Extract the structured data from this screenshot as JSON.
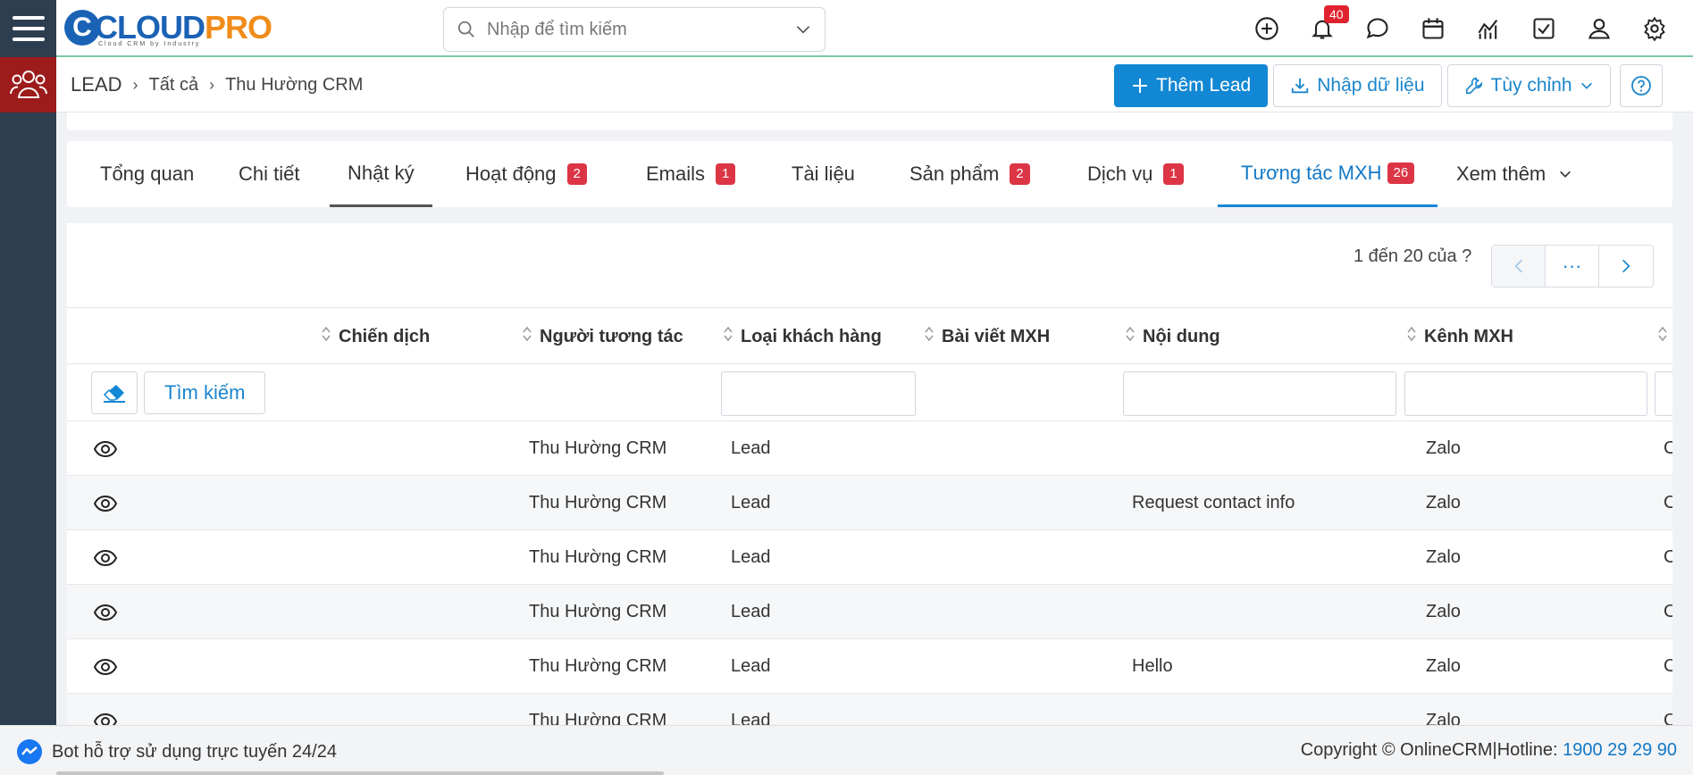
{
  "app": {
    "logo_brand": "CLOUDPRO",
    "logo_first": "CLOUD",
    "logo_second": "PRO",
    "logo_tagline": "Cloud CRM by Industry"
  },
  "header": {
    "search_placeholder": "Nhập để tìm kiếm",
    "notification_count": "40"
  },
  "breadcrumb": {
    "module": "LEAD",
    "level2": "Tất cả",
    "record": "Thu Hường CRM"
  },
  "actions": {
    "add": "Thêm Lead",
    "import": "Nhập dữ liệu",
    "customize": "Tùy chỉnh"
  },
  "tabs": [
    {
      "label": "Tổng quan",
      "badge": ""
    },
    {
      "label": "Chi tiết",
      "badge": ""
    },
    {
      "label": "Nhật ký",
      "badge": ""
    },
    {
      "label": "Hoạt động",
      "badge": "2"
    },
    {
      "label": "Emails",
      "badge": "1"
    },
    {
      "label": "Tài liệu",
      "badge": ""
    },
    {
      "label": "Sản phẩm",
      "badge": "2"
    },
    {
      "label": "Dịch vụ",
      "badge": "1"
    },
    {
      "label": "Tương tác MXH",
      "badge": "26"
    },
    {
      "label": "Xem thêm",
      "badge": ""
    }
  ],
  "pager": {
    "label": "1 đến 20 của",
    "unknown": "?",
    "more": "···"
  },
  "table": {
    "columns": [
      "Chiến dịch",
      "Người tương tác",
      "Loại khách hàng",
      "Bài viết MXH",
      "Nội dung",
      "Kênh MXH"
    ],
    "search_button": "Tìm kiếm",
    "rows": [
      {
        "campaign": "",
        "person": "Thu Hường CRM",
        "type": "Lead",
        "post": "",
        "content": "",
        "channel": "Zalo",
        "extra": "C"
      },
      {
        "campaign": "",
        "person": "Thu Hường CRM",
        "type": "Lead",
        "post": "",
        "content": "Request contact info",
        "channel": "Zalo",
        "extra": "C"
      },
      {
        "campaign": "",
        "person": "Thu Hường CRM",
        "type": "Lead",
        "post": "",
        "content": "",
        "channel": "Zalo",
        "extra": "C"
      },
      {
        "campaign": "",
        "person": "Thu Hường CRM",
        "type": "Lead",
        "post": "",
        "content": "",
        "channel": "Zalo",
        "extra": "C"
      },
      {
        "campaign": "",
        "person": "Thu Hường CRM",
        "type": "Lead",
        "post": "",
        "content": "Hello",
        "channel": "Zalo",
        "extra": "C"
      },
      {
        "campaign": "",
        "person": "Thu Hường CRM",
        "type": "Lead",
        "post": "",
        "content": "",
        "channel": "Zalo",
        "extra": "C"
      }
    ]
  },
  "footer": {
    "bot": "Bot hỗ trợ sử dụng trực tuyến 24/24",
    "copyright": "Copyright © OnlineCRM|Hotline: ",
    "hotline": "1900 29 29 90"
  },
  "colors": {
    "primary": "#1287d4",
    "sidebar": "#2c3e50",
    "module": "#9c1b1b",
    "badge": "#dc3545"
  }
}
